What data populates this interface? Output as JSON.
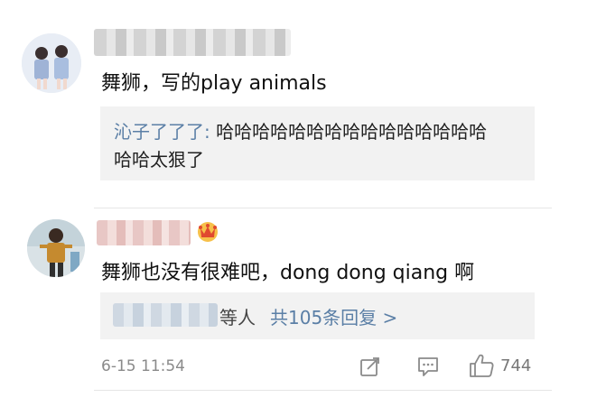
{
  "comments": [
    {
      "avatar_icon": "avatar-photo-two-girls",
      "username_blurred": true,
      "text": "舞狮，写的play  animals",
      "reply_preview": {
        "author": "沁子了了了:",
        "line1_text": " 哈哈哈哈哈哈哈哈哈哈哈哈哈哈哈",
        "line2_text": "哈哈太狠了"
      }
    },
    {
      "avatar_icon": "avatar-photo-dancer",
      "username_blurred": true,
      "badge_icon": "vip-crown-badge-icon",
      "text": "舞狮也没有很难吧，dong dong qiang 啊",
      "reply_summary": {
        "suffix": "等人",
        "link": "共105条回复 >"
      },
      "timestamp": "6-15 11:54",
      "actions": {
        "share_icon": "share-icon",
        "comment_icon": "comment-icon",
        "like_icon": "thumbs-up-icon",
        "like_count": "744"
      }
    }
  ],
  "colors": {
    "link": "#5b7fa6",
    "reply_background": "#f2f2f2",
    "muted_text": "#8a8a8a"
  }
}
